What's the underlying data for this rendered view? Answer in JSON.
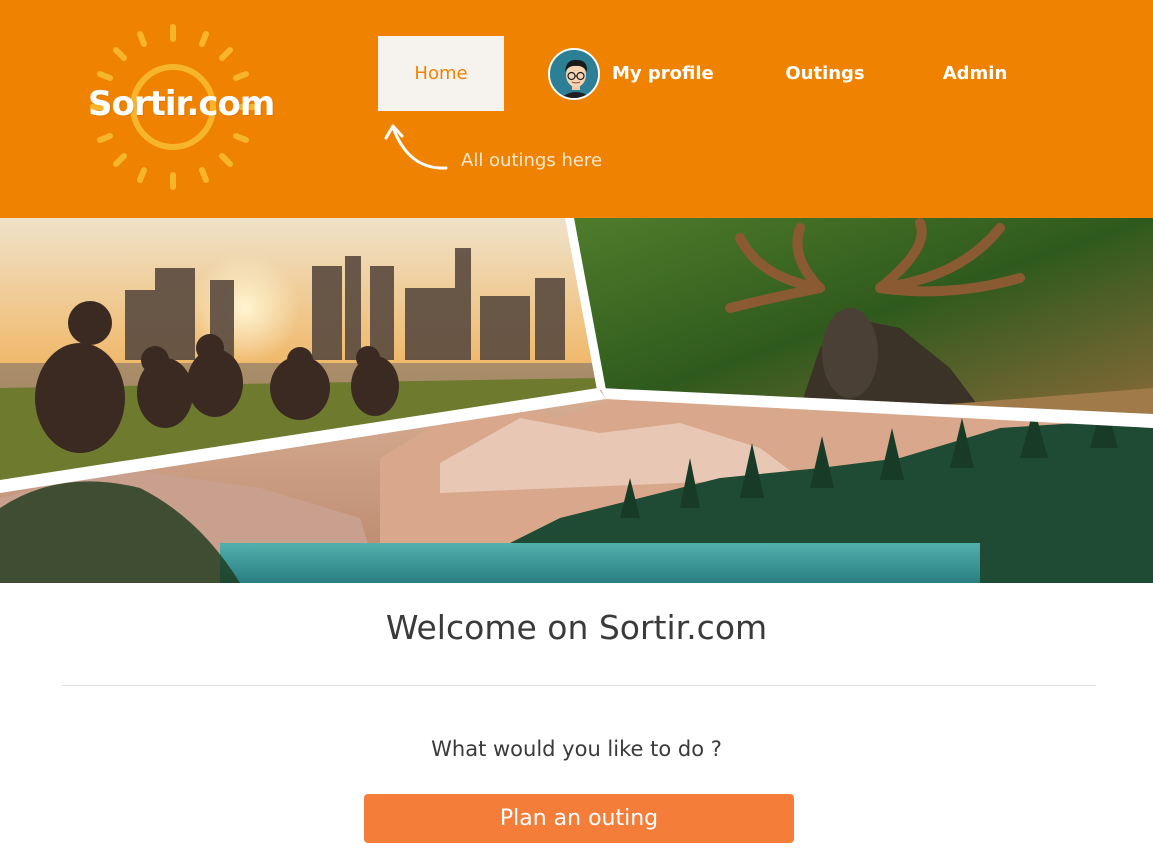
{
  "brand": {
    "logo_text": "Sortir.com",
    "primary_color": "#ef8200",
    "accent_color": "#f47d3a"
  },
  "nav": {
    "home_label": "Home",
    "profile_label": "My profile",
    "outings_label": "Outings",
    "admin_label": "Admin",
    "active_item": "Home",
    "hint_text": "All outings here"
  },
  "banner": {
    "images": [
      "city-skyline-picnic",
      "moose-in-grass",
      "mountain-lake-forest"
    ]
  },
  "main": {
    "welcome_title": "Welcome on Sortir.com",
    "question": "What would you like to do ?",
    "cta_label": "Plan an outing"
  }
}
